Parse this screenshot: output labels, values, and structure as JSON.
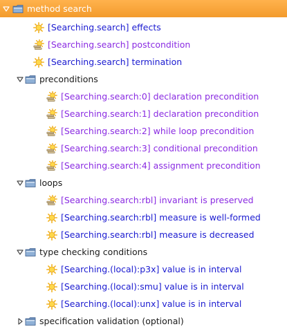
{
  "colors": {
    "selection": "#f7a33a",
    "folder_fill": "#8fb0d6",
    "folder_tab": "#6f93c0",
    "purple_label": "#8a2be2",
    "blue_label": "#1a1ad0"
  },
  "tree": [
    {
      "label": "method search",
      "kind": "folder",
      "state": "expanded",
      "selected": true,
      "level": 0
    },
    {
      "label": "[Searching.search] effects",
      "kind": "leaf",
      "icon": "sun-icon",
      "level": 1,
      "color": "blue"
    },
    {
      "label": "[Searching.search] postcondition",
      "kind": "leaf",
      "icon": "sun-stack-icon",
      "level": 1,
      "color": "purple"
    },
    {
      "label": "[Searching.search] termination",
      "kind": "leaf",
      "icon": "sun-icon",
      "level": 1,
      "color": "blue"
    },
    {
      "label": "preconditions",
      "kind": "folder",
      "state": "expanded",
      "level": 1
    },
    {
      "label": "[Searching.search:0] declaration precondition",
      "kind": "leaf",
      "icon": "sun-stack-icon",
      "level": 2,
      "color": "purple"
    },
    {
      "label": "[Searching.search:1] declaration precondition",
      "kind": "leaf",
      "icon": "sun-stack-icon",
      "level": 2,
      "color": "purple"
    },
    {
      "label": "[Searching.search:2] while loop precondition",
      "kind": "leaf",
      "icon": "sun-stack-icon",
      "level": 2,
      "color": "purple"
    },
    {
      "label": "[Searching.search:3] conditional precondition",
      "kind": "leaf",
      "icon": "sun-stack-icon",
      "level": 2,
      "color": "purple"
    },
    {
      "label": "[Searching.search:4] assignment precondition",
      "kind": "leaf",
      "icon": "sun-stack-icon",
      "level": 2,
      "color": "purple"
    },
    {
      "label": "loops",
      "kind": "folder",
      "state": "expanded",
      "level": 1
    },
    {
      "label": "[Searching.search:rbl] invariant is preserved",
      "kind": "leaf",
      "icon": "sun-stack-icon",
      "level": 2,
      "color": "purple"
    },
    {
      "label": "[Searching.search:rbl] measure is well-formed",
      "kind": "leaf",
      "icon": "sun-icon",
      "level": 2,
      "color": "blue"
    },
    {
      "label": "[Searching.search:rbl] measure is decreased",
      "kind": "leaf",
      "icon": "sun-icon",
      "level": 2,
      "color": "blue"
    },
    {
      "label": "type checking conditions",
      "kind": "folder",
      "state": "expanded",
      "level": 1
    },
    {
      "label": "[Searching.(local):p3x] value is in interval",
      "kind": "leaf",
      "icon": "sun-icon",
      "level": 2,
      "color": "blue"
    },
    {
      "label": "[Searching.(local):smu] value is in interval",
      "kind": "leaf",
      "icon": "sun-icon",
      "level": 2,
      "color": "blue"
    },
    {
      "label": "[Searching.(local):unx] value is in interval",
      "kind": "leaf",
      "icon": "sun-icon",
      "level": 2,
      "color": "blue"
    },
    {
      "label": "specification validation (optional)",
      "kind": "folder",
      "state": "collapsed",
      "level": 1
    }
  ]
}
